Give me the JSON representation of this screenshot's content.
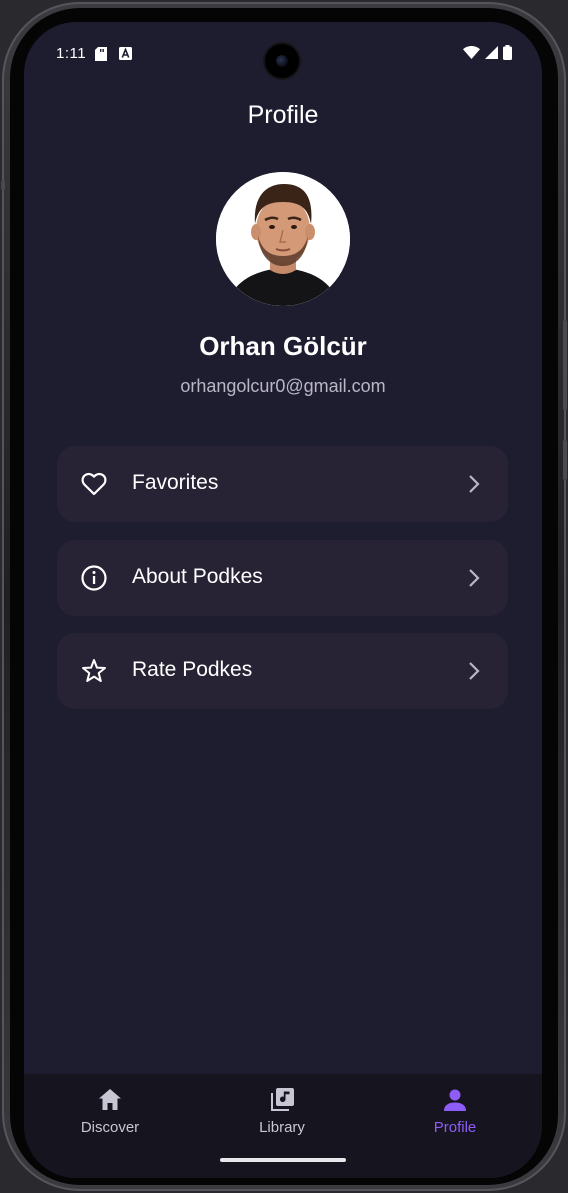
{
  "status_bar": {
    "time": "1:11"
  },
  "page": {
    "title": "Profile"
  },
  "profile": {
    "name": "Orhan Gölcür",
    "email": "orhangolcur0@gmail.com"
  },
  "menu": {
    "items": [
      {
        "label": "Favorites",
        "icon": "heart-icon"
      },
      {
        "label": "About Podkes",
        "icon": "info-icon"
      },
      {
        "label": "Rate Podkes",
        "icon": "star-icon"
      }
    ]
  },
  "bottom_nav": {
    "items": [
      {
        "label": "Discover",
        "icon": "home-icon",
        "active": false
      },
      {
        "label": "Library",
        "icon": "library-music-icon",
        "active": false
      },
      {
        "label": "Profile",
        "icon": "person-icon",
        "active": true
      }
    ]
  },
  "colors": {
    "background": "#1e1c2f",
    "card": "#272334",
    "accent": "#8e5cf7",
    "nav_background": "#16141f"
  }
}
